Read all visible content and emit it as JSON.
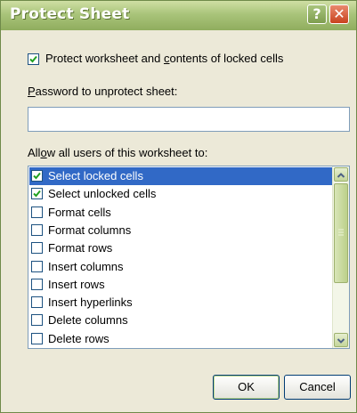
{
  "window": {
    "title": "Protect Sheet",
    "help_label": "?",
    "close_label": "✕"
  },
  "protect": {
    "checked": true,
    "label_prefix": "Protect worksheet and ",
    "label_underlined": "c",
    "label_suffix": "ontents of locked cells"
  },
  "password": {
    "label_underlined": "P",
    "label_rest": "assword to unprotect sheet:",
    "value": ""
  },
  "allow": {
    "label_prefix": "All",
    "label_underlined": "o",
    "label_suffix": "w all users of this worksheet to:"
  },
  "options": [
    {
      "label": "Select locked cells",
      "checked": true,
      "selected": true
    },
    {
      "label": "Select unlocked cells",
      "checked": true,
      "selected": false
    },
    {
      "label": "Format cells",
      "checked": false,
      "selected": false
    },
    {
      "label": "Format columns",
      "checked": false,
      "selected": false
    },
    {
      "label": "Format rows",
      "checked": false,
      "selected": false
    },
    {
      "label": "Insert columns",
      "checked": false,
      "selected": false
    },
    {
      "label": "Insert rows",
      "checked": false,
      "selected": false
    },
    {
      "label": "Insert hyperlinks",
      "checked": false,
      "selected": false
    },
    {
      "label": "Delete columns",
      "checked": false,
      "selected": false
    },
    {
      "label": "Delete rows",
      "checked": false,
      "selected": false
    }
  ],
  "buttons": {
    "ok": "OK",
    "cancel": "Cancel"
  },
  "icons": {
    "checkmark": "checkmark-icon",
    "up": "scroll-up-arrow-icon",
    "down": "scroll-down-arrow-icon",
    "grip": "scroll-grip-icon"
  },
  "colors": {
    "accent": "#3169c6",
    "check": "#21a121",
    "title_bar": "#a9c47a"
  }
}
